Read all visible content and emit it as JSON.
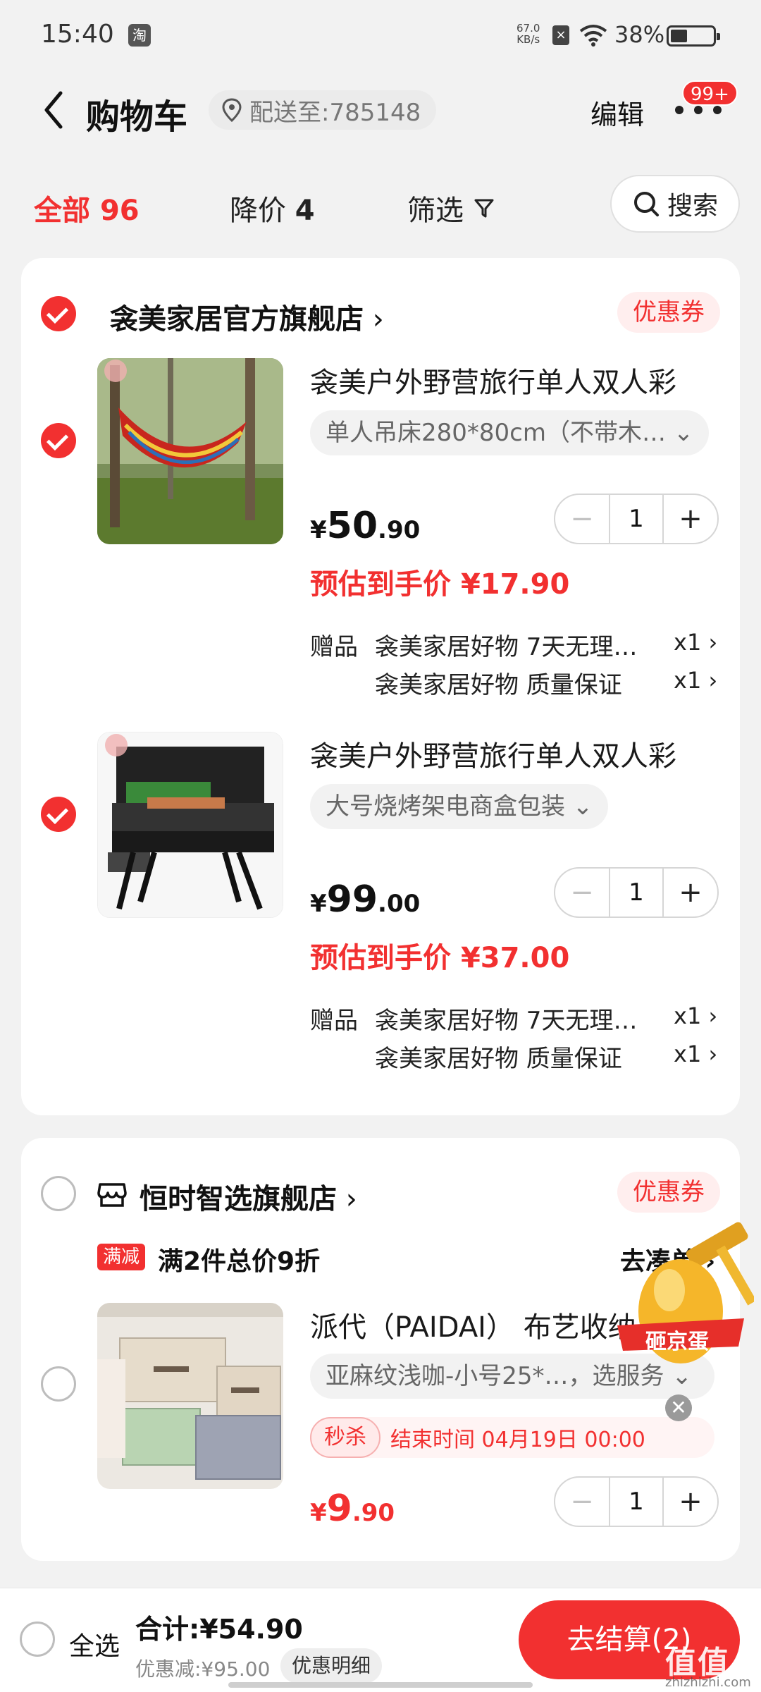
{
  "status_bar": {
    "time": "15:40",
    "app_badge": "淘",
    "net_speed_value": "67.0",
    "net_speed_unit": "KB/s",
    "battery": "38%"
  },
  "header": {
    "title": "购物车",
    "address": "配送至:785148",
    "edit": "编辑",
    "badge": "99+"
  },
  "tabs": {
    "all_label": "全部",
    "all_count": "96",
    "drop_label": "降价",
    "drop_count": "4",
    "filter_label": "筛选",
    "search_label": "搜索"
  },
  "shop1": {
    "name": "衾美家居官方旗舰店",
    "coupon": "优惠券",
    "products": [
      {
        "title": "衾美户外野营旅行单人双人彩",
        "sku": "单人吊床280*80cm（不带木…",
        "price_symbol": "¥",
        "price_int": "50",
        "price_dec": ".90",
        "est_label": "预估到手价",
        "est_price": "¥17.90",
        "qty": "1",
        "gift_label": "赠品",
        "gifts": [
          {
            "text": "衾美家居好物 7天无理…",
            "qty": "x1"
          },
          {
            "text": "衾美家居好物 质量保证",
            "qty": "x1"
          }
        ]
      },
      {
        "title": "衾美户外野营旅行单人双人彩",
        "sku": "大号烧烤架电商盒包装",
        "price_symbol": "¥",
        "price_int": "99",
        "price_dec": ".00",
        "est_label": "预估到手价",
        "est_price": "¥37.00",
        "qty": "1",
        "gift_label": "赠品",
        "gifts": [
          {
            "text": "衾美家居好物 7天无理…",
            "qty": "x1"
          },
          {
            "text": "衾美家居好物 质量保证",
            "qty": "x1"
          }
        ]
      }
    ]
  },
  "shop2": {
    "name": "恒时智选旗舰店",
    "coupon": "优惠券",
    "promo_badge": "满减",
    "promo_text": "满2件总价9折",
    "promo_link": "去凑单",
    "product": {
      "title": "派代（PAIDAI） 布艺收纳",
      "sku": "亚麻纹浅咖-小号25*…，选服务",
      "flash_tag": "秒杀",
      "flash_time": "结束时间 04月19日 00:00",
      "price_symbol": "¥",
      "price_int": "9",
      "price_dec": ".90",
      "qty": "1"
    }
  },
  "floating": {
    "egg_label": "砸京蛋"
  },
  "bottom": {
    "select_all": "全选",
    "total": "合计:¥54.90",
    "discount": "优惠减:¥95.00",
    "discount_detail": "优惠明细",
    "checkout": "去结算(2)"
  },
  "watermark": {
    "main": "值值值",
    "sub": "zhizhizhi.com"
  },
  "colors": {
    "accent": "#f23030",
    "background": "#f2f2f2"
  }
}
